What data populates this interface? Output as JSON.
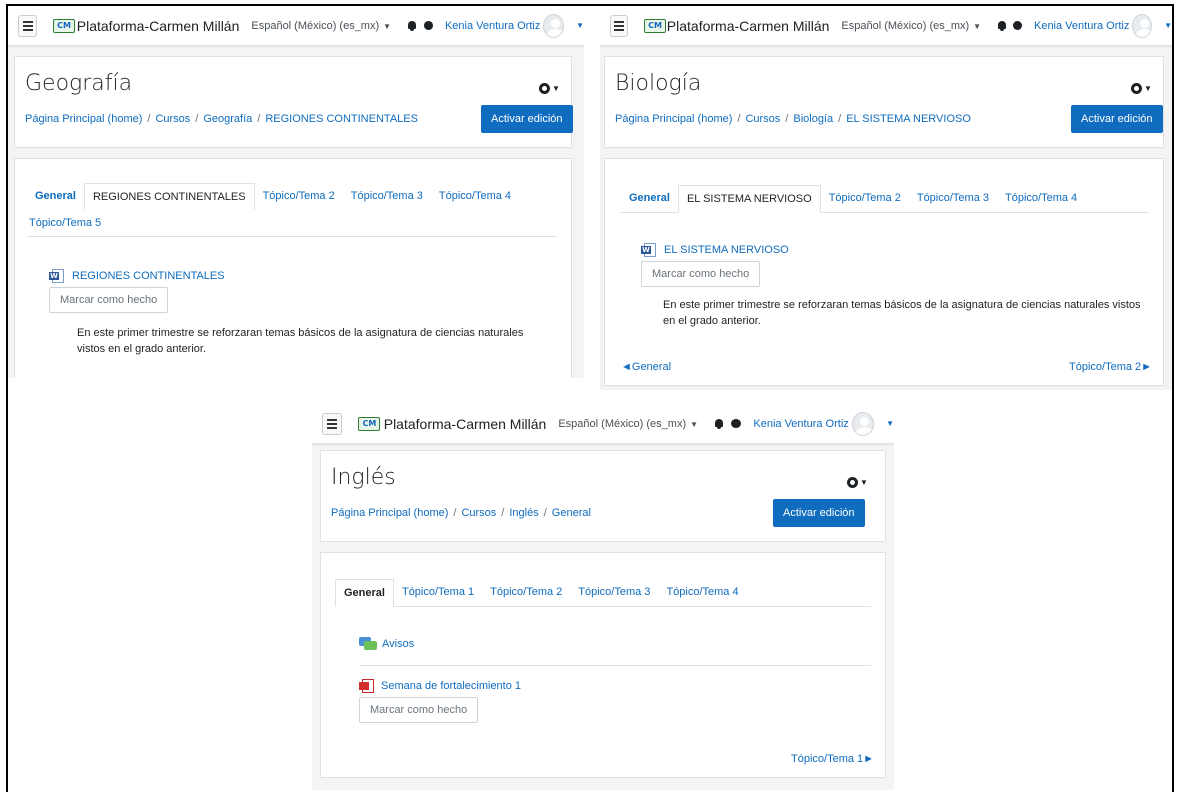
{
  "shared": {
    "site_name": "Plataforma-Carmen Millán",
    "logo_text": "CM",
    "language": "Español (México) (es_mx)",
    "user_name": "Kenia Ventura Ortiz",
    "edit_button": "Activar edición",
    "mark_done": "Marcar como hecho",
    "crumb_home": "Página Principal (home)",
    "crumb_courses": "Cursos",
    "separator": "/"
  },
  "geografia": {
    "title": "Geografía",
    "crumb_course": "Geografía",
    "crumb_section": "REGIONES CONTINENTALES",
    "tabs": [
      "General",
      "REGIONES CONTINENTALES",
      "Tópico/Tema 2",
      "Tópico/Tema 3",
      "Tópico/Tema 4",
      "Tópico/Tema 5"
    ],
    "activity": "REGIONES CONTINENTALES",
    "summary": "En este primer trimestre se reforzaran temas básicos de la asignatura de ciencias naturales vistos en el grado anterior."
  },
  "biologia": {
    "title": "Biología",
    "crumb_course": "Biología",
    "crumb_section": "EL SISTEMA NERVIOSO",
    "tabs": [
      "General",
      "EL SISTEMA NERVIOSO",
      "Tópico/Tema 2",
      "Tópico/Tema 3",
      "Tópico/Tema 4"
    ],
    "activity": "EL SISTEMA NERVIOSO",
    "summary": "En este primer trimestre se reforzaran temas básicos de la asignatura de ciencias naturales vistos en el grado anterior.",
    "prev_link": "◄General",
    "next_link": "Tópico/Tema 2►"
  },
  "ingles": {
    "title": "Inglés",
    "crumb_course": "Inglés",
    "crumb_section": "General",
    "tabs": [
      "General",
      "Tópico/Tema 1",
      "Tópico/Tema 2",
      "Tópico/Tema 3",
      "Tópico/Tema 4"
    ],
    "forum": "Avisos",
    "resource": "Semana de fortalecimiento 1",
    "next_link": "Tópico/Tema 1►"
  }
}
